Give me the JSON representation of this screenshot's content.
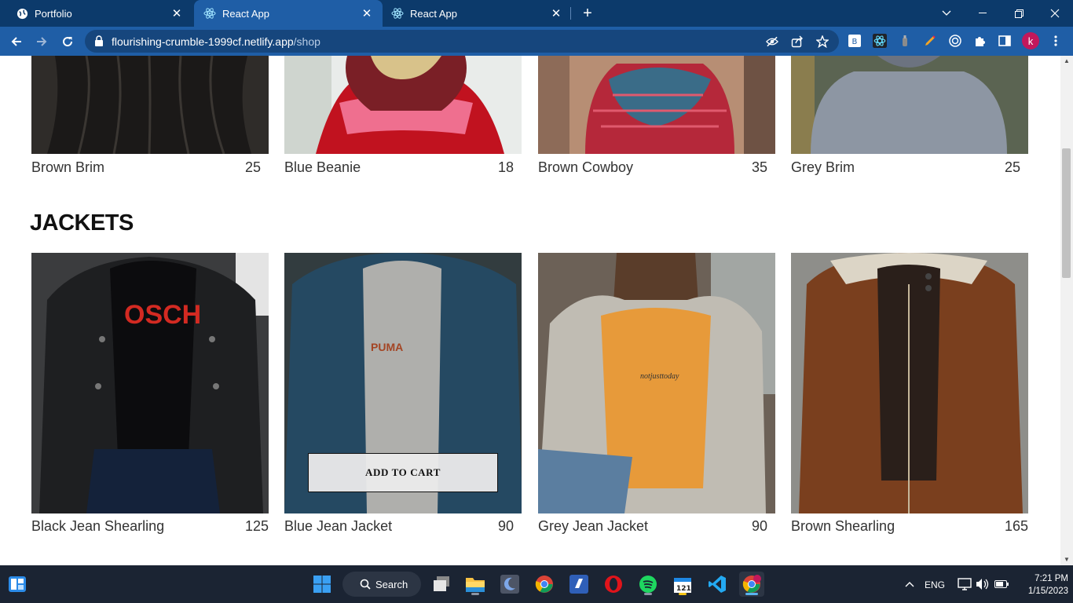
{
  "browser": {
    "tabs": [
      {
        "title": "Portfolio",
        "icon": "globe-icon",
        "active": false
      },
      {
        "title": "React App",
        "icon": "react-icon",
        "active": true
      },
      {
        "title": "React App",
        "icon": "react-icon",
        "active": false
      }
    ],
    "url_host": "flourishing-crumble-1999cf.netlify.app",
    "url_path": "/shop",
    "profile_initial": "k"
  },
  "shop": {
    "hats": [
      {
        "name": "Brown Brim",
        "price": "25"
      },
      {
        "name": "Blue Beanie",
        "price": "18"
      },
      {
        "name": "Brown Cowboy",
        "price": "35"
      },
      {
        "name": "Grey Brim",
        "price": "25"
      }
    ],
    "jackets_title": "JACKETS",
    "jackets": [
      {
        "name": "Black Jean Shearling",
        "price": "125"
      },
      {
        "name": "Blue Jean Jacket",
        "price": "90"
      },
      {
        "name": "Grey Jean Jacket",
        "price": "90"
      },
      {
        "name": "Brown Shearling",
        "price": "165"
      }
    ],
    "add_to_cart_label": "ADD TO CART"
  },
  "taskbar": {
    "search_label": "Search",
    "language": "ENG",
    "time": "7:21 PM",
    "date": "1/15/2023",
    "calendar_badge": "121"
  },
  "colors": {
    "tab_strip": "#0c3a6b",
    "toolbar": "#1f5ea6",
    "taskbar": "#1b2433"
  }
}
